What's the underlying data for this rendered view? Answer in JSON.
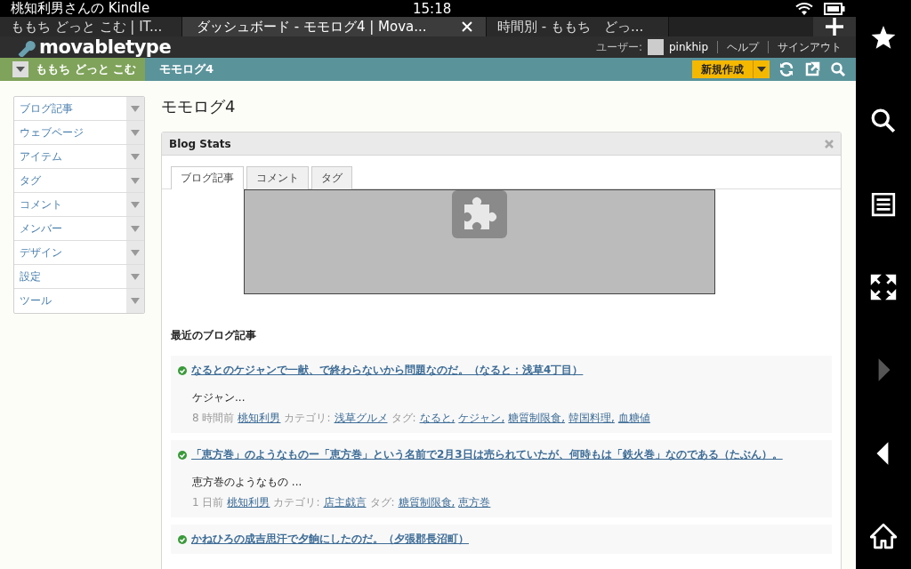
{
  "status_bar": {
    "title": "桃知利男さんの Kindle",
    "time": "15:18"
  },
  "browser_tabs": [
    {
      "label": "ももち どっと こむ | IT...",
      "selected": false
    },
    {
      "label": "ダッシュボード - モモログ4 | Mova...",
      "selected": true
    },
    {
      "label": "時間別 - ももち　どっ...",
      "selected": false
    }
  ],
  "mt_header": {
    "logo": "movabletype",
    "user_label": "ユーザー:",
    "user": "pinkhip",
    "links": [
      "ヘルプ",
      "サインアウト"
    ]
  },
  "breadcrumb": {
    "site": "ももち どっと こむ",
    "blog": "モモログ4",
    "new_button": "新規作成"
  },
  "menu": [
    {
      "label": "ブログ記事"
    },
    {
      "label": "ウェブページ"
    },
    {
      "label": "アイテム"
    },
    {
      "label": "タグ"
    },
    {
      "label": "コメント"
    },
    {
      "label": "メンバー"
    },
    {
      "label": "デザイン"
    },
    {
      "label": "設定"
    },
    {
      "label": "ツール"
    }
  ],
  "page_title": "モモログ4",
  "widget": {
    "title": "Blog Stats",
    "tabs": [
      {
        "label": "ブログ記事",
        "selected": true
      },
      {
        "label": "コメント",
        "selected": false
      },
      {
        "label": "タグ",
        "selected": false
      }
    ],
    "section_title": "最近のブログ記事",
    "entries": [
      {
        "title": "なるとのケジャンで一献、で終わらないから問題なのだ。（なると：浅草4丁目）",
        "excerpt": "ケジャン...",
        "time": "8 時間前",
        "author": "桃知利男",
        "category_label": "カテゴリ:",
        "category": "浅草グルメ",
        "tag_label": "タグ:",
        "tags": [
          "なると,",
          "ケジャン,",
          "糖質制限食,",
          "韓国料理,",
          "血糖値"
        ]
      },
      {
        "title": "「恵方巻」のようなものー「恵方巻」という名前で2月3日は売られていたが、何時もは「鉄火巻」なのである（たぶん）。",
        "excerpt": "恵方巻のようなもの ...",
        "time": "1 日前",
        "author": "桃知利男",
        "category_label": "カテゴリ:",
        "category": "店主戯言",
        "tag_label": "タグ:",
        "tags": [
          "糖質制限食,",
          "恵方巻"
        ]
      },
      {
        "title": "かねひろの成吉思汗で夕餉にしたのだ。（夕張郡長沼町）"
      }
    ]
  },
  "side_buttons": [
    {
      "kind": "star",
      "disabled": false
    },
    {
      "kind": "search",
      "disabled": false
    },
    {
      "kind": "menu",
      "disabled": false
    },
    {
      "kind": "fullscreen",
      "disabled": false
    },
    {
      "kind": "forward",
      "disabled": true
    },
    {
      "kind": "back",
      "disabled": false
    },
    {
      "kind": "home",
      "disabled": false
    }
  ]
}
